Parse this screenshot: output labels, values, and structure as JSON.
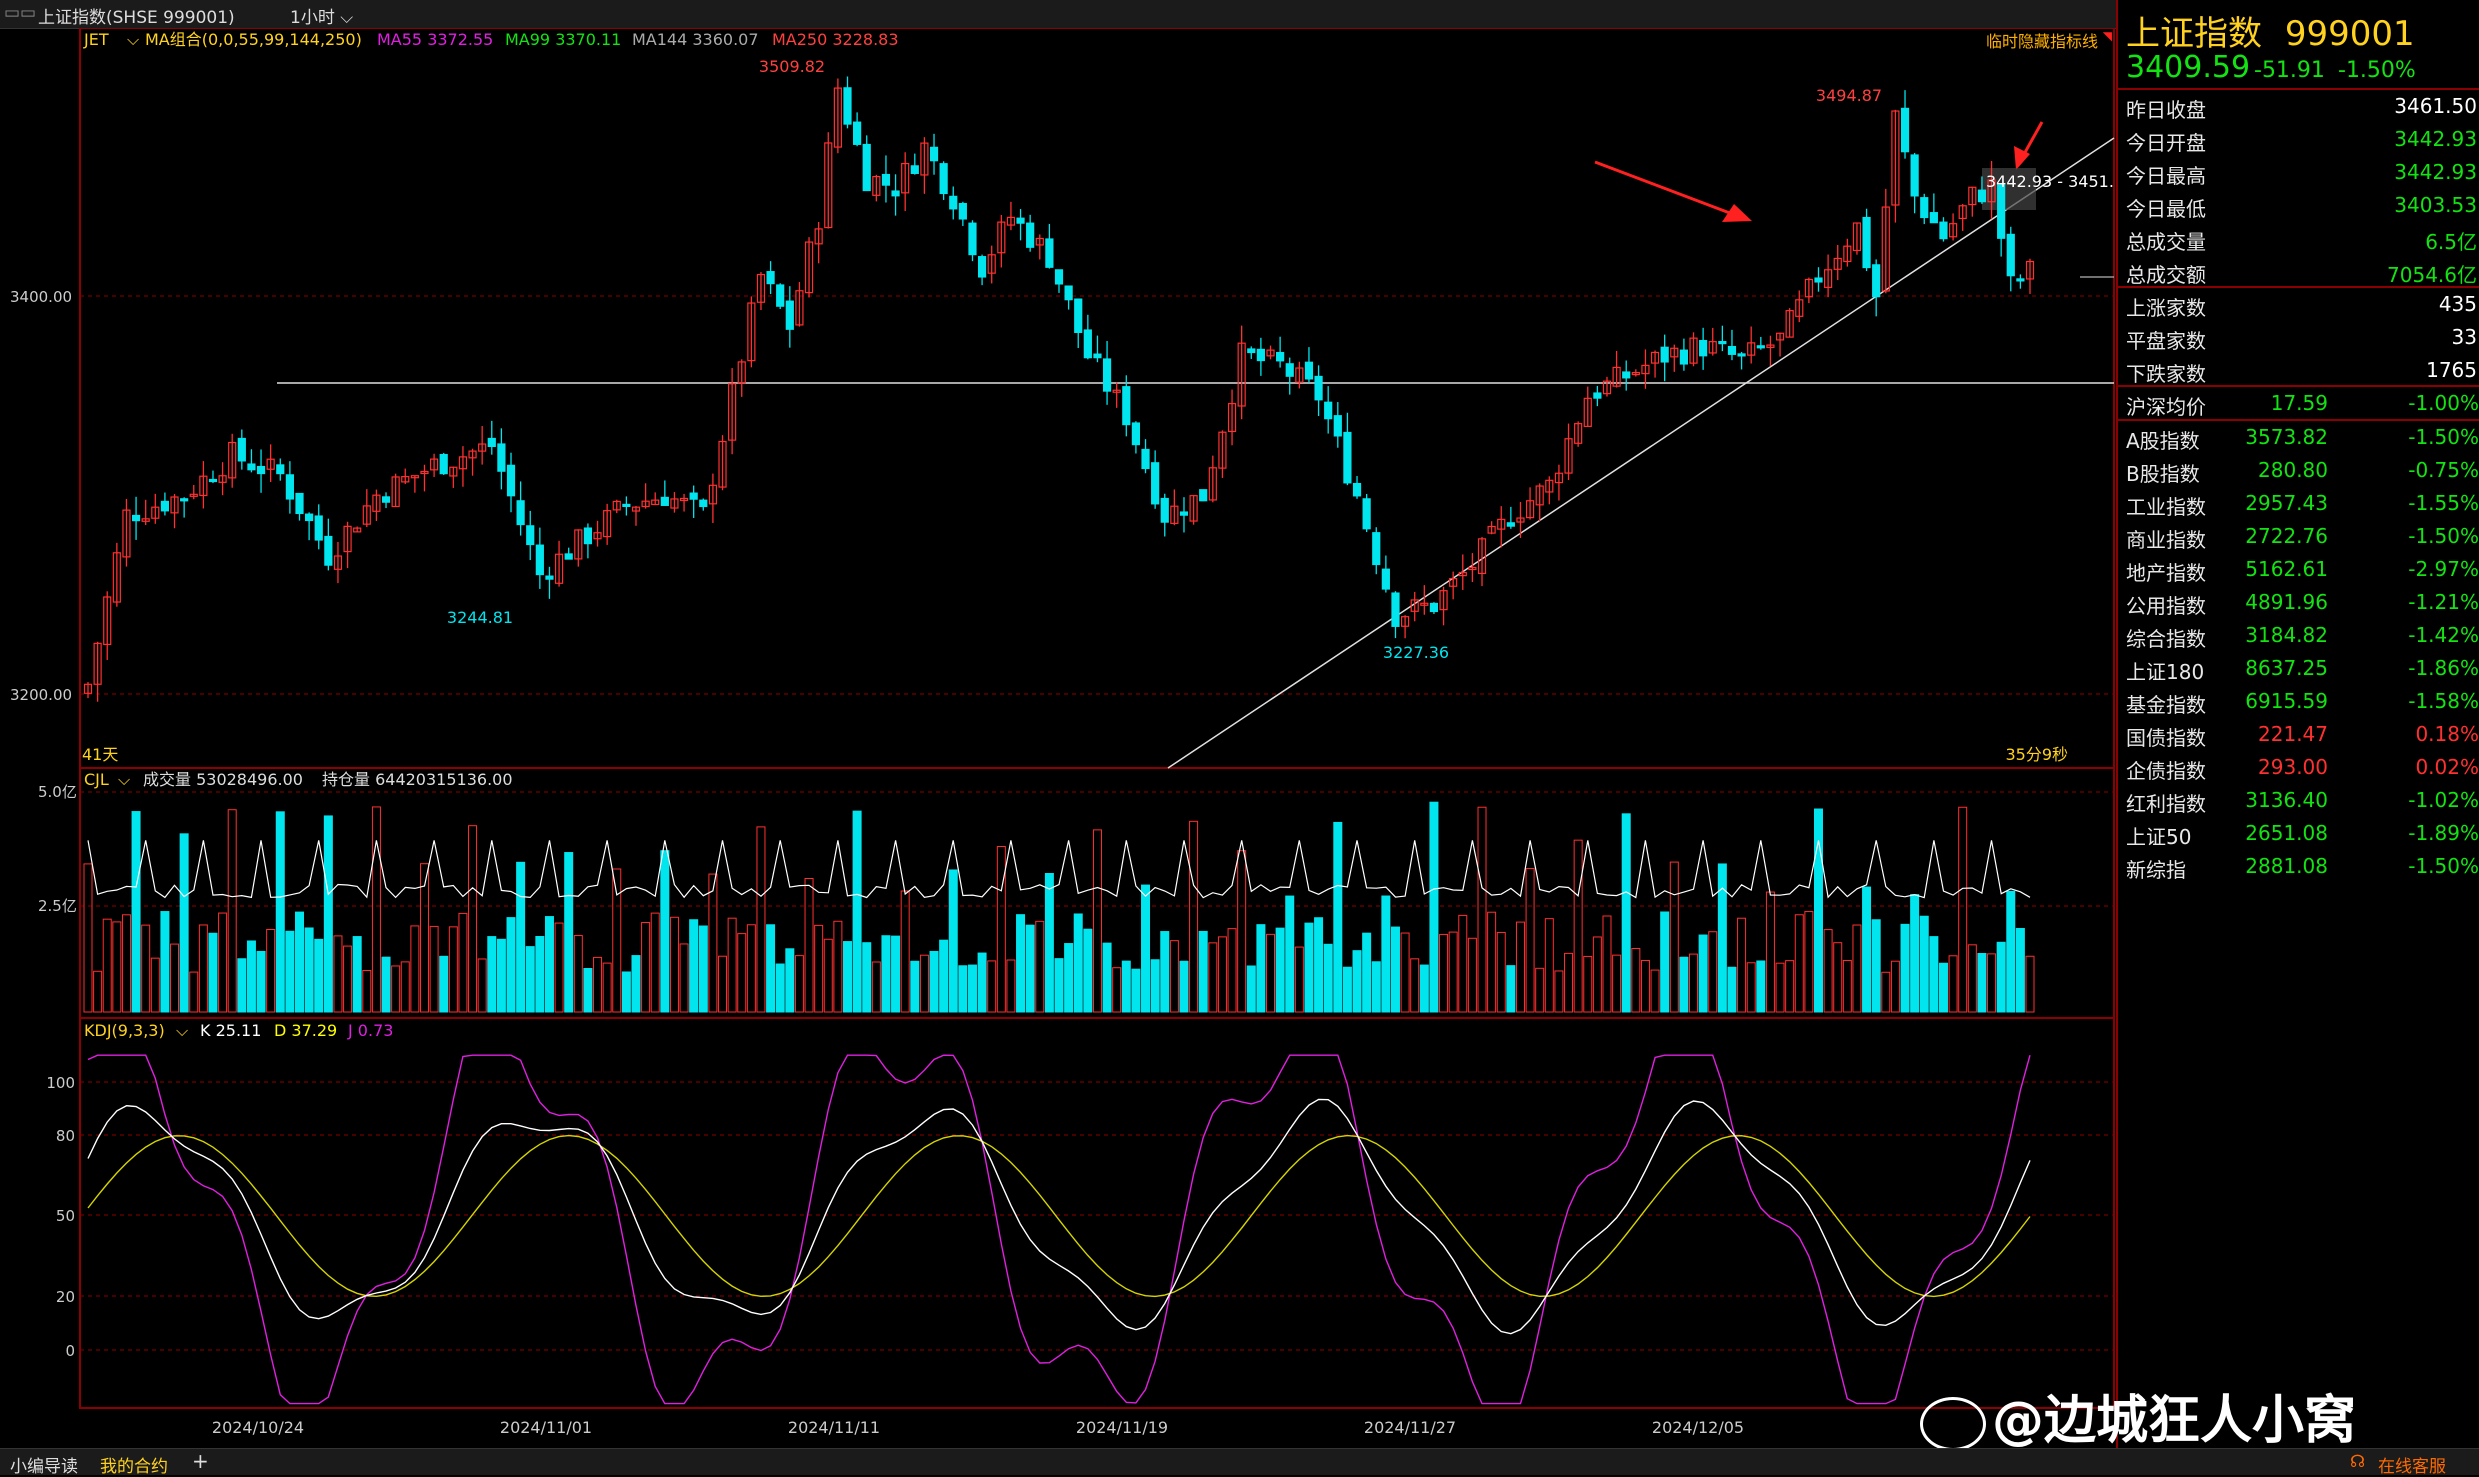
{
  "titlebar": {
    "title": "上证指数(SHSE 999001)",
    "period": "1小时"
  },
  "main_legend": {
    "jet": "JET",
    "ma_group": "MA组合(0,0,55,99,144,250)",
    "ma55": "MA55 3372.55",
    "ma99": "MA99 3370.11",
    "ma144": "MA144 3360.07",
    "ma250": "MA250 3228.83",
    "hide_hint": "临时隐藏指标线"
  },
  "price_labels": {
    "high1": "3509.82",
    "high2": "3494.87",
    "low1": "3244.81",
    "low2": "3227.36",
    "range": "3442.93 - 3451."
  },
  "price_axis": {
    "tick1": "3400.00",
    "tick2": "3200.00"
  },
  "main_footer": {
    "days": "41天",
    "countdown": "35分9秒"
  },
  "volume_legend": {
    "name": "CJL",
    "volume": "成交量 53028496.00",
    "oi": "持仓量 64420315136.00"
  },
  "volume_axis": {
    "tick1": "5.0亿",
    "tick2": "2.5亿"
  },
  "kdj_legend": {
    "name": "KDJ(9,3,3)",
    "k": "K 25.11",
    "d": "D 37.29",
    "j": "J 0.73"
  },
  "kdj_axis": [
    "100",
    "80",
    "50",
    "20",
    "0"
  ],
  "dates": [
    "2024/10/24",
    "2024/11/01",
    "2024/11/11",
    "2024/11/19",
    "2024/11/27",
    "2024/12/05"
  ],
  "colors": {
    "up": "#ff3030",
    "down": "#00e5ee",
    "ma_white": "#ffffff",
    "ma_yellow": "#d4d400",
    "kdj_j": "#e020e0",
    "grid": "#8b0000"
  },
  "quote": {
    "name": "上证指数",
    "code": "999001",
    "last": "3409.59",
    "change": "-51.91",
    "change_pct": "-1.50%",
    "stats": [
      {
        "label": "昨日收盘",
        "value": "3461.50",
        "color": "#ffffff"
      },
      {
        "label": "今日开盘",
        "value": "3442.93",
        "color": "#13e313"
      },
      {
        "label": "今日最高",
        "value": "3442.93",
        "color": "#13e313"
      },
      {
        "label": "今日最低",
        "value": "3403.53",
        "color": "#13e313"
      },
      {
        "label": "总成交量",
        "value": "6.5亿",
        "color": "#13e313"
      },
      {
        "label": "总成交额",
        "value": "7054.6亿",
        "color": "#13e313"
      }
    ],
    "breadth": [
      {
        "label": "上涨家数",
        "value": "435",
        "color": "#ffffff"
      },
      {
        "label": "平盘家数",
        "value": "33",
        "color": "#ffffff"
      },
      {
        "label": "下跌家数",
        "value": "1765",
        "color": "#ffffff"
      }
    ],
    "avg": {
      "label": "沪深均价",
      "value": "17.59",
      "pct": "-1.00%"
    }
  },
  "indices": [
    {
      "name": "A股指数",
      "value": "3573.82",
      "pct": "-1.50%",
      "color": "#13e313"
    },
    {
      "name": "B股指数",
      "value": "280.80",
      "pct": "-0.75%",
      "color": "#13e313"
    },
    {
      "name": "工业指数",
      "value": "2957.43",
      "pct": "-1.55%",
      "color": "#13e313"
    },
    {
      "name": "商业指数",
      "value": "2722.76",
      "pct": "-1.50%",
      "color": "#13e313"
    },
    {
      "name": "地产指数",
      "value": "5162.61",
      "pct": "-2.97%",
      "color": "#13e313"
    },
    {
      "name": "公用指数",
      "value": "4891.96",
      "pct": "-1.21%",
      "color": "#13e313"
    },
    {
      "name": "综合指数",
      "value": "3184.82",
      "pct": "-1.42%",
      "color": "#13e313"
    },
    {
      "name": "上证180",
      "value": "8637.25",
      "pct": "-1.86%",
      "color": "#13e313"
    },
    {
      "name": "基金指数",
      "value": "6915.59",
      "pct": "-1.58%",
      "color": "#13e313"
    },
    {
      "name": "国债指数",
      "value": "221.47",
      "pct": "0.18%",
      "color": "#ff3030"
    },
    {
      "name": "企债指数",
      "value": "293.00",
      "pct": "0.02%",
      "color": "#ff3030"
    },
    {
      "name": "红利指数",
      "value": "3136.40",
      "pct": "-1.02%",
      "color": "#13e313"
    },
    {
      "name": "上证50",
      "value": "2651.08",
      "pct": "-1.89%",
      "color": "#13e313"
    },
    {
      "name": "新综指",
      "value": "2881.08",
      "pct": "-1.50%",
      "color": "#13e313"
    }
  ],
  "bottombar": {
    "tab1": "小编导读",
    "tab2": "我的合约",
    "add": "+",
    "service": "在线客服"
  },
  "watermark": "@边城狂人小窝"
}
